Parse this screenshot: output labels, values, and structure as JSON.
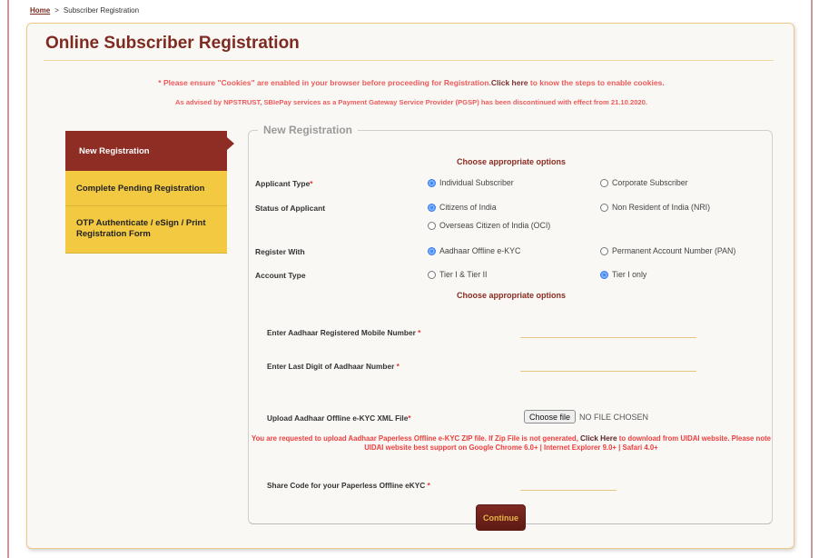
{
  "breadcrumb": {
    "home": "Home",
    "separator": ">",
    "current": "Subscriber Registration"
  },
  "page": {
    "title": "Online Subscriber Registration"
  },
  "notices": {
    "cookies_prefix": "* Please ensure \"Cookies\" are enabled in your browser before proceeding for Registration.",
    "cookies_link": "Click here",
    "cookies_suffix": " to know the steps to enable cookies.",
    "pgsp": "As advised by NPSTRUST, SBIePay services as a Payment Gateway Service Provider (PGSP) has been discontinued with effect from 21.10.2020."
  },
  "sidebar": {
    "items": [
      {
        "label": "New Registration",
        "active": true
      },
      {
        "label": "Complete Pending Registration",
        "active": false
      },
      {
        "label": "OTP Authenticate / eSign / Print Registration Form",
        "active": false
      }
    ]
  },
  "form": {
    "legend": "New Registration",
    "subheading_1": "Choose appropriate options",
    "subheading_2": "Choose appropriate options",
    "required_mark": "*",
    "applicant_type": {
      "label": "Applicant Type",
      "options": [
        "Individual Subscriber",
        "Corporate Subscriber"
      ],
      "selected": "Individual Subscriber"
    },
    "status_of_applicant": {
      "label": "Status of Applicant",
      "options": [
        "Citizens of India",
        "Non Resident of India (NRI)",
        "Overseas Citizen of India (OCI)"
      ],
      "selected": "Citizens of India"
    },
    "register_with": {
      "label": "Register With",
      "options": [
        "Aadhaar Offline e-KYC",
        "Permanent Account Number (PAN)"
      ],
      "selected": "Aadhaar Offline e-KYC"
    },
    "account_type": {
      "label": "Account Type",
      "options": [
        "Tier I & Tier II",
        "Tier I only"
      ],
      "selected": "Tier I only"
    },
    "mobile": {
      "label": "Enter Aadhaar Registered Mobile Number ",
      "value": ""
    },
    "last_digit": {
      "label": "Enter Last Digit of Aadhaar Number ",
      "value": ""
    },
    "upload": {
      "label": "Upload Aadhaar Offline e-KYC XML File",
      "button": "Choose file",
      "status": "NO FILE CHOSEN"
    },
    "upload_note": {
      "prefix": "You are requested to upload Aadhaar Paperless Offline e-KYC ZIP file. If Zip File is not generated, ",
      "link": "Click Here",
      "suffix": " to download from UIDAI website. Please note UIDAI website best support on Google Chrome 6.0+ | Internet Explorer 9.0+ | Safari 4.0+"
    },
    "share_code": {
      "label": "Share Code for your Paperless Offline eKYC ",
      "value": ""
    },
    "continue_label": "Continue"
  },
  "colors": {
    "brand_maroon": "#8e2d24",
    "tab_yellow": "#f3c942",
    "notice_red": "#ee5a5a",
    "radio_blue": "#3d86f7"
  }
}
